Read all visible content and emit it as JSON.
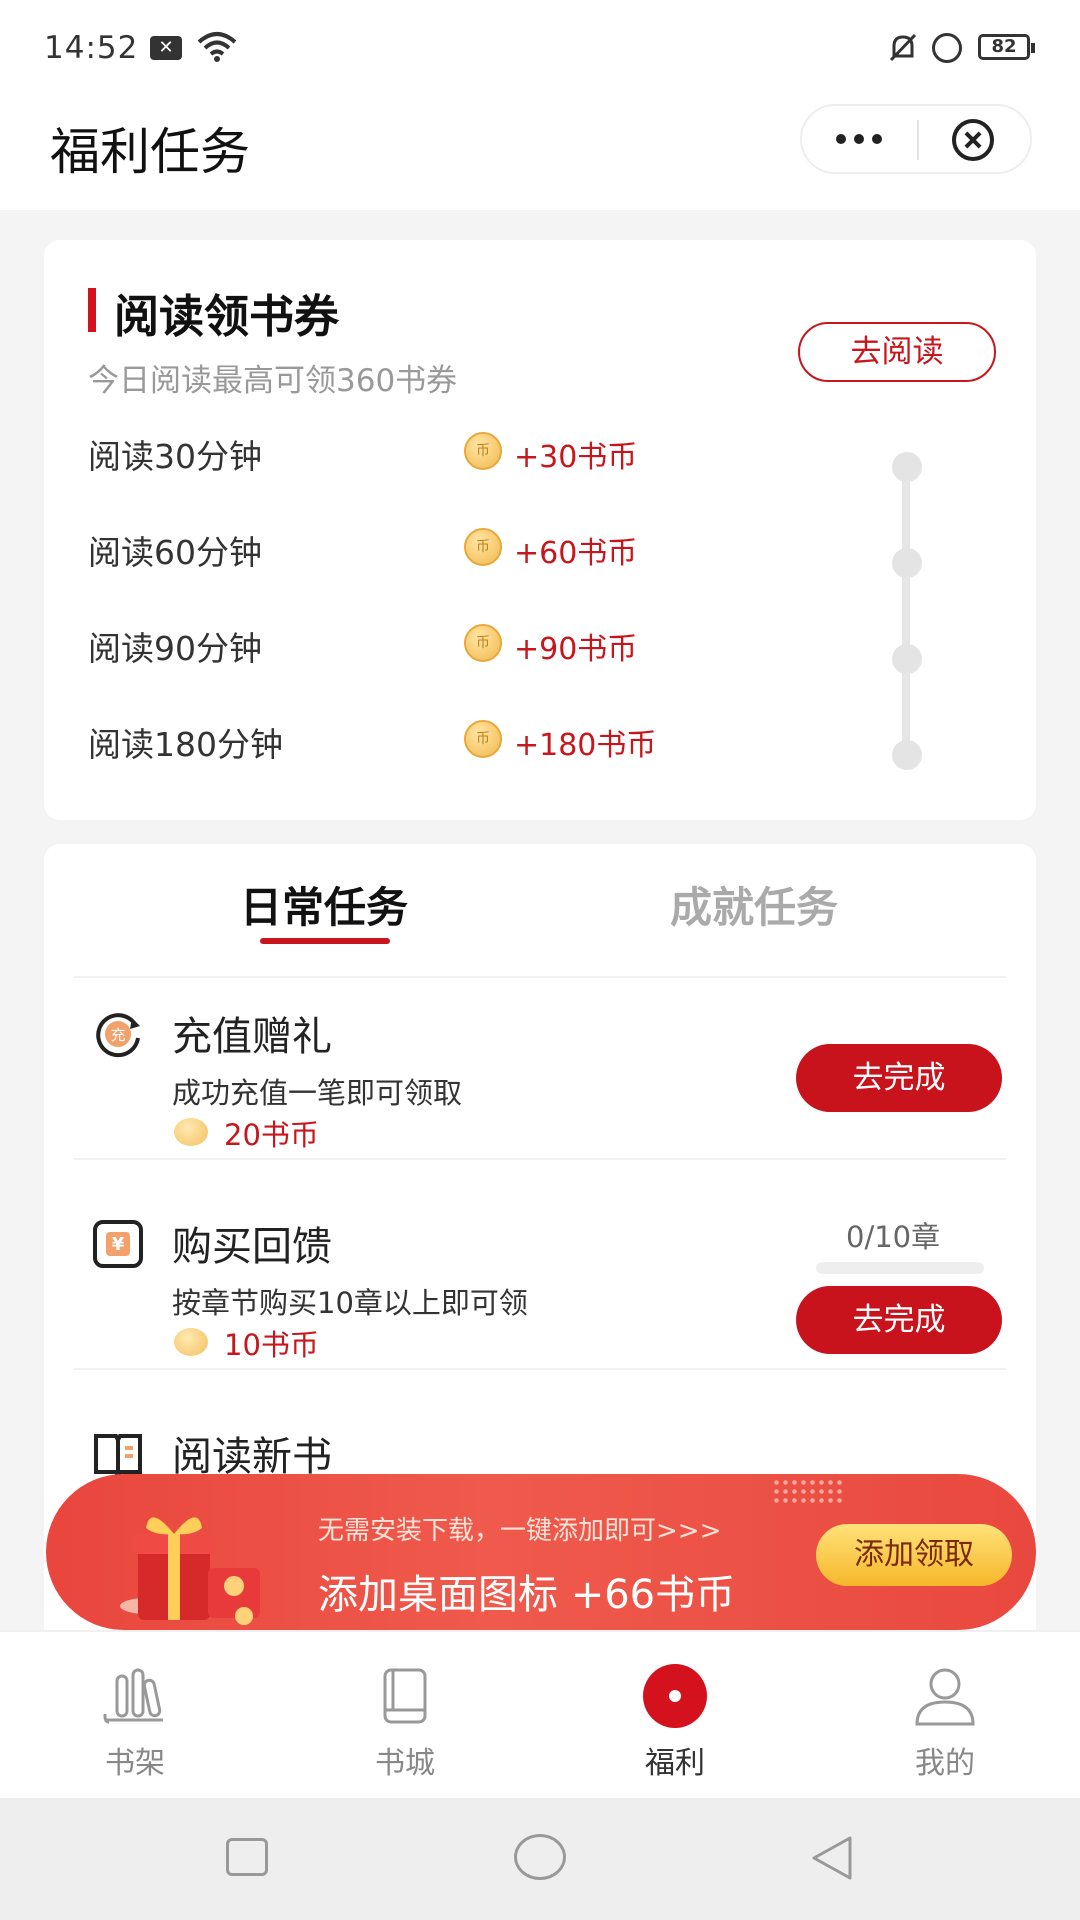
{
  "status_bar": {
    "time": "14:52",
    "battery": "82"
  },
  "header": {
    "title": "福利任务"
  },
  "reading_card": {
    "title": "阅读领书券",
    "subtitle": "今日阅读最高可领360书券",
    "button": "去阅读",
    "coin_glyph": "币",
    "milestones": [
      {
        "label": "阅读30分钟",
        "reward": "+30书币"
      },
      {
        "label": "阅读60分钟",
        "reward": "+60书币"
      },
      {
        "label": "阅读90分钟",
        "reward": "+90书币"
      },
      {
        "label": "阅读180分钟",
        "reward": "+180书币"
      }
    ]
  },
  "tasks_card": {
    "tabs": [
      {
        "label": "日常任务",
        "active": true
      },
      {
        "label": "成就任务",
        "active": false
      }
    ],
    "tasks": [
      {
        "icon": "recharge-icon",
        "icon_glyph": "充",
        "name": "充值赠礼",
        "desc": "成功充值一笔即可领取",
        "reward": "20书币",
        "button": "去完成"
      },
      {
        "icon": "purchase-icon",
        "icon_glyph": "¥",
        "name": "购买回馈",
        "desc": "按章节购买10章以上即可领",
        "reward": "10书币",
        "button": "去完成",
        "progress_text": "0/10章",
        "progress": 0
      },
      {
        "icon": "book-icon",
        "name": "阅读新书"
      }
    ]
  },
  "banner": {
    "small_text": "无需安装下载，一键添加即可>>>",
    "big_text": "添加桌面图标 +66书币",
    "button": "添加领取"
  },
  "bottom_nav": {
    "items": [
      {
        "label": "书架",
        "icon": "bookshelf-icon"
      },
      {
        "label": "书城",
        "icon": "bookstore-icon"
      },
      {
        "label": "福利",
        "icon": "welfare-icon",
        "active": true
      },
      {
        "label": "我的",
        "icon": "profile-icon"
      }
    ]
  },
  "colors": {
    "accent": "#c8161d",
    "muted": "#999999",
    "coin": "#f2b84a"
  }
}
